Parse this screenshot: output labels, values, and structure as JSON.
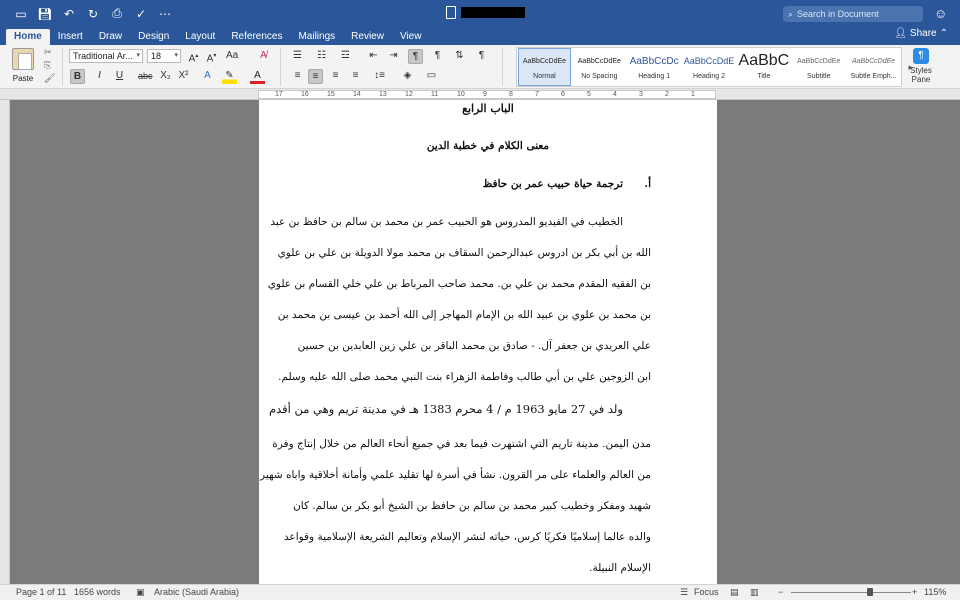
{
  "quick_access": {
    "icons": [
      "sidebar-icon",
      "save-icon",
      "undo-icon",
      "redo-icon",
      "print-icon",
      "spelling-icon",
      "customize-icon"
    ]
  },
  "title_bar": {
    "search_placeholder": "Search in Document"
  },
  "tabs": [
    "Home",
    "Insert",
    "Draw",
    "Design",
    "Layout",
    "References",
    "Mailings",
    "Review",
    "View"
  ],
  "active_tab": "Home",
  "share_label": "Share",
  "ribbon": {
    "paste_label": "Paste",
    "font_name": "Traditional Ar...",
    "font_size": "18",
    "format_buttons": [
      "B",
      "I",
      "U",
      "abc",
      "X₂",
      "X²"
    ],
    "styles": [
      {
        "preview": "AaBbCcDdEe",
        "name": "Normal",
        "selected": true
      },
      {
        "preview": "AaBbCcDdEe",
        "name": "No Spacing",
        "selected": false
      },
      {
        "preview": "AaBbCcDc",
        "name": "Heading 1",
        "selected": false
      },
      {
        "preview": "AaBbCcDdE",
        "name": "Heading 2",
        "selected": false
      },
      {
        "preview": "AaBbC",
        "name": "Title",
        "selected": false
      },
      {
        "preview": "AaBbCcDdEe",
        "name": "Subtitle",
        "selected": false
      },
      {
        "preview": "AaBbCcDdEe",
        "name": "Subtle Emph...",
        "selected": false
      }
    ],
    "styles_pane_label": "Styles Pane"
  },
  "ruler": {
    "ticks": [
      "17",
      "16",
      "15",
      "14",
      "13",
      "12",
      "11",
      "10",
      "9",
      "8",
      "7",
      "6",
      "5",
      "4",
      "3",
      "2",
      "1"
    ]
  },
  "document": {
    "chapter_title": "الباب الرابع",
    "section_title": "معنى الكلام في خطبة الدين",
    "subsection_marker": "أ.",
    "subsection_title": "ترجمة حياة حبيب عمر بن حافظ",
    "paragraph1_lines": [
      "الخطيب في الفيديو المدروس هو الحبيب عمر بن محمد بن سالم بن حافظ بن عبد",
      "الله بن أبي بكر بن ادروس عبدالرحمن السقاف بن محمد مولا الدويلة بن علي بن علوي",
      "بن الفقيه المقدم محمد بن علي بن. محمد صاحب المرباط بن علي خلي القسام بن علوي",
      "بن محمد بن علوي بن عبيد الله بن الإمام المهاجر إلى الله أحمد بن عيسى بن محمد بن",
      "علي العريدي بن جعفر آل. - صادق بن محمد الباقر بن علي زين العابدين بن حسين",
      "ابن الزوجين علي بن أبي طالب وفاطمة الزهراء بنت النبي محمد صلى الله عليه وسلم."
    ],
    "paragraph2_lines": [
      "ولد في 27 مايو 1963 م / 4 محرم 1383 هـ في مدينة تريم وهي من أقدم",
      "مدن اليمن. مدينة تاريم التي اشتهرت فيما بعد في جميع أنحاء العالم من خلال إنتاج وفرة",
      "من العالم والعلماء على مر القرون. نشأ في أسرة لها تقليد علمي وأمانة أخلاقية واباه شهير",
      "شهيد ومفكر وخطيب كبير محمد بن سالم بن حافظ بن الشيخ أبو بكر بن سالم. كان",
      "والده عالما إسلاميًا فكريًا كرس، حياته لنشر الإسلام وتعاليم الشريعة الإسلامية وقواعد",
      "الإسلام النبيلة."
    ]
  },
  "status_bar": {
    "page": "Page 1 of 11",
    "words": "1656 words",
    "language": "Arabic (Saudi Arabia)",
    "focus": "Focus",
    "zoom": "115%"
  }
}
